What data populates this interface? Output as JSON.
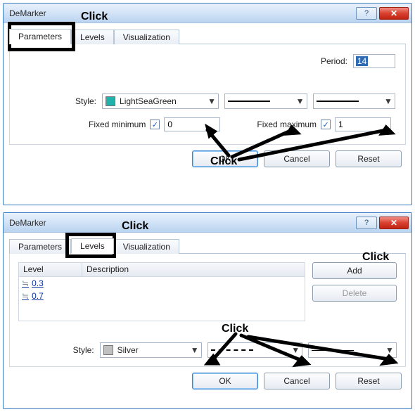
{
  "dialog1": {
    "title": "DeMarker",
    "tabs": {
      "parameters": "Parameters",
      "levels": "Levels",
      "visualization": "Visualization"
    },
    "period_label": "Period:",
    "period_value": "14",
    "style_label": "Style:",
    "color_name": "LightSeaGreen",
    "color_hex": "#20B2AA",
    "fixed_min_label": "Fixed minimum",
    "fixed_min_value": "0",
    "fixed_max_label": "Fixed maximum",
    "fixed_max_value": "1",
    "buttons": {
      "ok": "OK",
      "cancel": "Cancel",
      "reset": "Reset"
    }
  },
  "dialog2": {
    "title": "DeMarker",
    "tabs": {
      "parameters": "Parameters",
      "levels": "Levels",
      "visualization": "Visualization"
    },
    "grid": {
      "head_level": "Level",
      "head_desc": "Description",
      "rows": [
        {
          "level": "0.3",
          "desc": ""
        },
        {
          "level": "0.7",
          "desc": ""
        }
      ]
    },
    "add_label": "Add",
    "delete_label": "Delete",
    "style_label": "Style:",
    "color_name": "Silver",
    "color_hex": "#C0C0C0",
    "buttons": {
      "ok": "OK",
      "cancel": "Cancel",
      "reset": "Reset"
    }
  },
  "annotations": {
    "click": "Click"
  }
}
